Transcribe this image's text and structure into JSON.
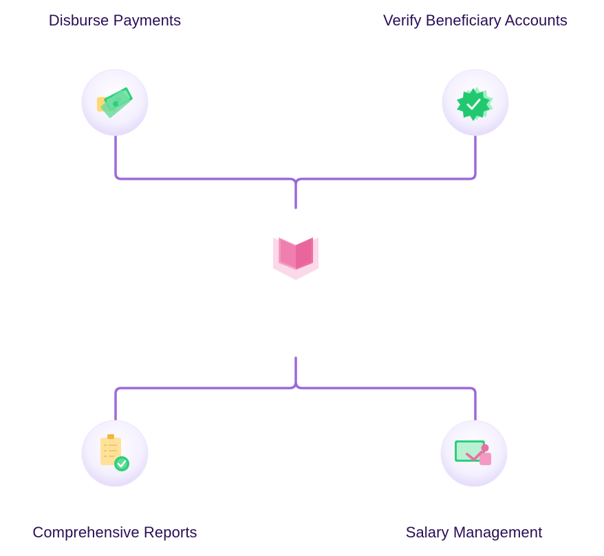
{
  "features": {
    "top_left": {
      "label": "Disburse Payments",
      "icon": "money-notes-icon"
    },
    "top_right": {
      "label": "Verify Beneficiary Accounts",
      "icon": "verified-badge-icon"
    },
    "bottom_left": {
      "label": "Comprehensive Reports",
      "icon": "checked-clipboard-icon"
    },
    "bottom_right": {
      "label": "Salary Management",
      "icon": "presentation-board-icon"
    }
  },
  "center": {
    "icon": "open-book-icon"
  },
  "colors": {
    "connector": "#9b6ad8",
    "label_text": "#2a0d55",
    "node_fill": "#f1ecfd",
    "book": "#ec6fa4",
    "green": "#2ecf7d",
    "yellow": "#ffd873"
  }
}
